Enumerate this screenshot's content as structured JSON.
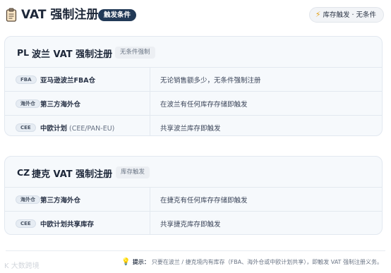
{
  "header": {
    "icon": "clipboard-icon",
    "title": "VAT 强制注册",
    "badge": "触发条件",
    "chip_icon": "bolt-icon",
    "chip_label": "库存触发 · 无条件"
  },
  "cards": [
    {
      "code": "PL",
      "name": "波兰 VAT 强制注册",
      "tag": "无条件强制",
      "rows": [
        {
          "pill": "FBA",
          "label": "亚马逊波兰FBA仓",
          "sub": "",
          "desc": "无论销售额多少，无条件强制注册"
        },
        {
          "pill": "海外仓",
          "label": "第三方海外仓",
          "sub": "",
          "desc": "在波兰有任何库存存储即触发"
        },
        {
          "pill": "CEE",
          "label": "中欧计划",
          "sub": "(CEE/PAN-EU)",
          "desc": "共享波兰库存即触发"
        }
      ]
    },
    {
      "code": "CZ",
      "name": "捷克 VAT 强制注册",
      "tag": "库存触发",
      "rows": [
        {
          "pill": "海外仓",
          "label": "第三方海外仓",
          "sub": "",
          "desc": "在捷克有任何库存存储即触发"
        },
        {
          "pill": "CEE",
          "label": "中欧计划共享库存",
          "sub": "",
          "desc": "共享捷克库存即触发"
        }
      ]
    }
  ],
  "footer": {
    "icon": "lightbulb-icon",
    "lead": "提示：",
    "text": "只要在波兰 / 捷克境内有库存（FBA、海外仓或中欧计划共享），即触发 VAT 强制注册义务。"
  },
  "watermark": "K 大数跨境"
}
